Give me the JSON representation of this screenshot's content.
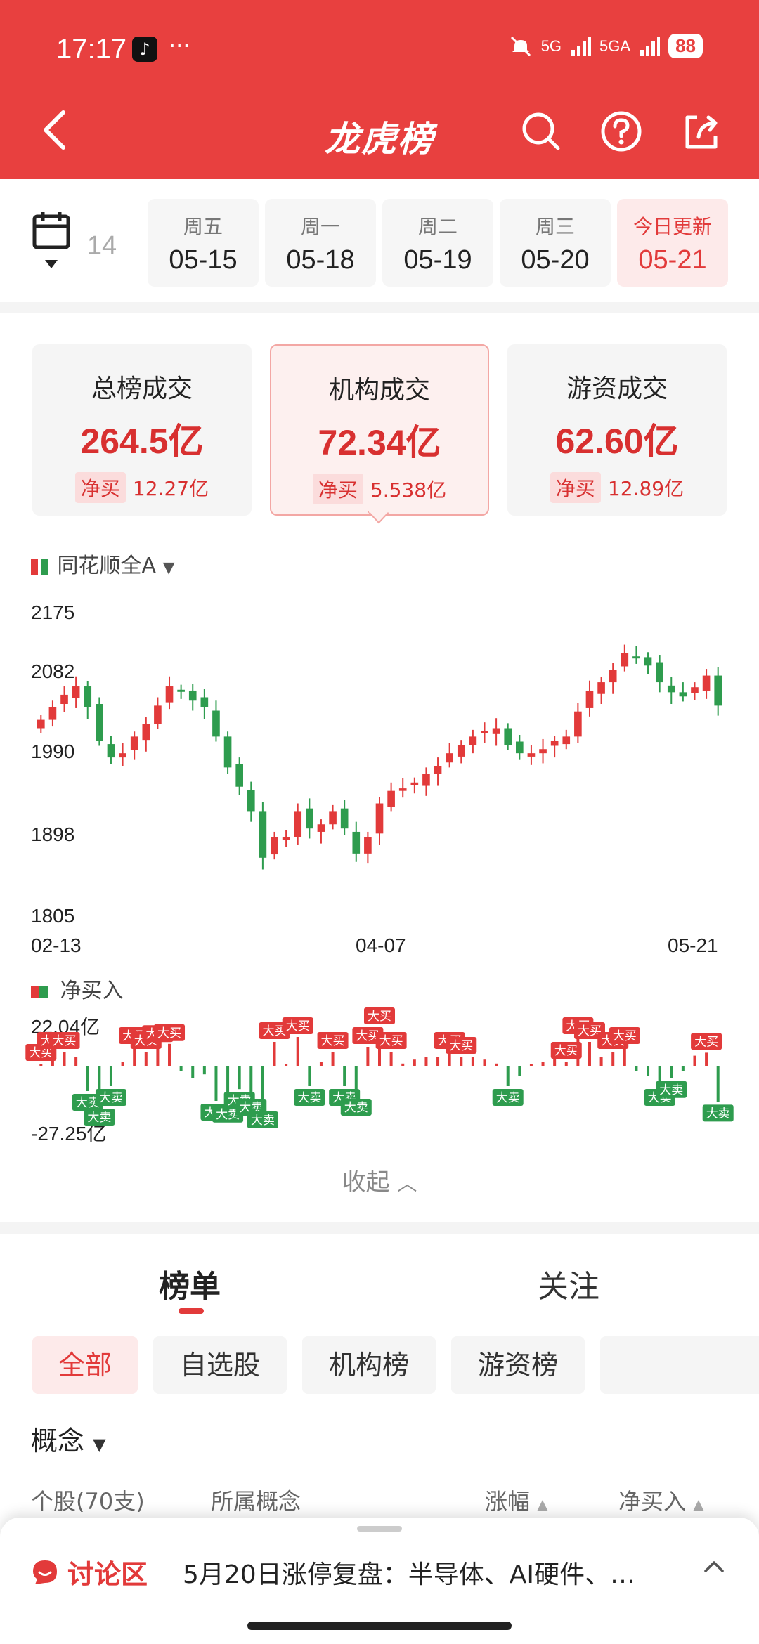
{
  "status": {
    "time": "17:17",
    "tiktok": "♪",
    "dots": "···",
    "net1": "5G",
    "net2": "5GA",
    "battery": "88"
  },
  "nav": {
    "title": "龙虎榜"
  },
  "dates": [
    {
      "weekday": "",
      "date": "14",
      "state": "partial"
    },
    {
      "weekday": "周五",
      "date": "05-15",
      "state": "normal"
    },
    {
      "weekday": "周一",
      "date": "05-18",
      "state": "normal"
    },
    {
      "weekday": "周二",
      "date": "05-19",
      "state": "normal"
    },
    {
      "weekday": "周三",
      "date": "05-20",
      "state": "normal"
    },
    {
      "weekday": "今日更新",
      "date": "05-21",
      "state": "active"
    }
  ],
  "cards": [
    {
      "title": "总榜成交",
      "value": "264.5亿",
      "net_label": "净买",
      "net_value": "12.27亿"
    },
    {
      "title": "机构成交",
      "value": "72.34亿",
      "net_label": "净买",
      "net_value": "5.538亿"
    },
    {
      "title": "游资成交",
      "value": "62.60亿",
      "net_label": "净买",
      "net_value": "12.89亿"
    }
  ],
  "chart": {
    "index_name": "同花顺全A",
    "y_ticks": [
      "2175",
      "2082",
      "1990",
      "1898",
      "1805"
    ],
    "x_ticks": [
      "02-13",
      "04-07",
      "05-21"
    ],
    "flow_label": "净买入",
    "flow_max": "22.04亿",
    "flow_min": "-27.25亿",
    "big_buy": "大买",
    "big_sell": "大卖"
  },
  "chart_data": {
    "type": "candlestick",
    "title": "同花顺全A",
    "x_labels": [
      "02-13",
      "04-07",
      "05-21"
    ],
    "ylim": [
      1805,
      2175
    ],
    "closes": [
      2045,
      2060,
      2075,
      2085,
      2060,
      2020,
      2000,
      2005,
      2025,
      2040,
      2062,
      2085,
      2080,
      2068,
      2060,
      2025,
      1988,
      1965,
      1935,
      1880,
      1905,
      1905,
      1935,
      1915,
      1920,
      1935,
      1915,
      1885,
      1905,
      1945,
      1960,
      1963,
      1970,
      1980,
      1990,
      2005,
      2015,
      2025,
      2032,
      2035,
      2015,
      2005,
      2005,
      2010,
      2020,
      2025,
      2055,
      2080,
      2090,
      2105,
      2125,
      2120,
      2110,
      2090,
      2078,
      2073,
      2084,
      2098,
      2062
    ]
  },
  "tabs": {
    "list": "榜单",
    "follow": "关注"
  },
  "chips": [
    "全部",
    "自选股",
    "机构榜",
    "游资榜"
  ],
  "concept": "概念",
  "table_head": {
    "stocks": "个股(70支)",
    "concept": "所属概念",
    "change": "涨幅",
    "netbuy": "净买入"
  },
  "collapse": "收起",
  "discussion": {
    "label": "讨论区",
    "news": "5月20日涨停复盘：半导体、AI硬件、…"
  },
  "colors": {
    "brand_red": "#e8403f",
    "up": "#e23a3a",
    "down": "#2e9c4e"
  }
}
